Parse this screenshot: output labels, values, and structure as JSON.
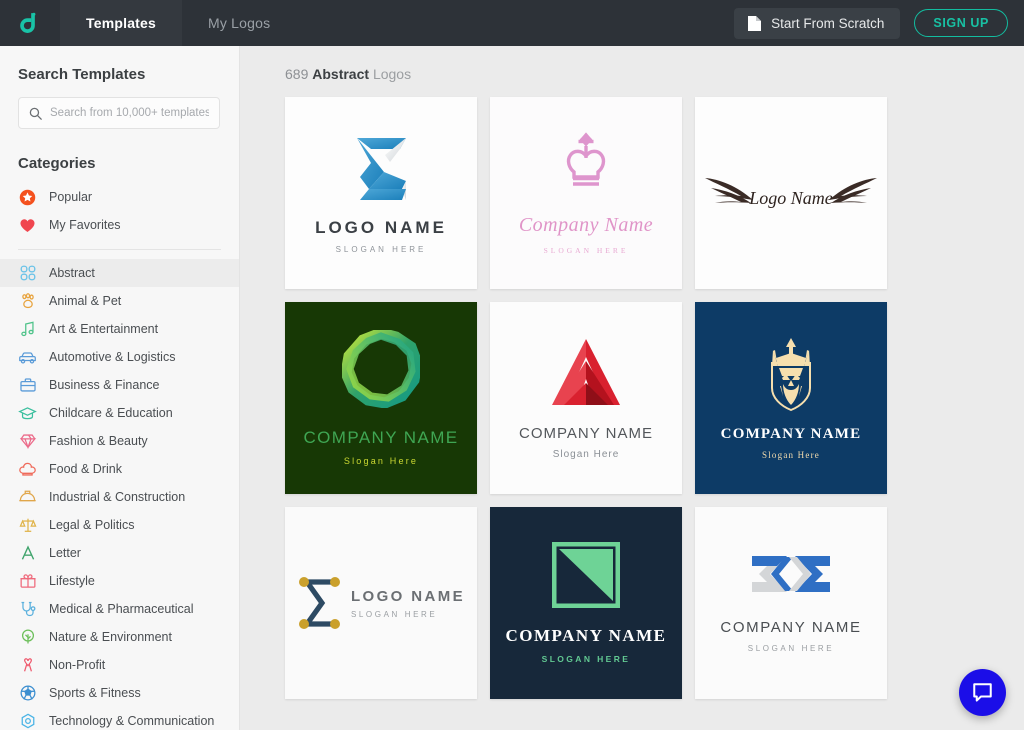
{
  "topbar": {
    "brand_icon": "logo-mark-icon",
    "tabs": [
      {
        "label": "Templates",
        "active": true
      },
      {
        "label": "My Logos",
        "active": false
      }
    ],
    "scratch_label": "Start From Scratch",
    "scratch_icon": "document-icon",
    "signup_label": "SIGN UP",
    "colors": {
      "bar_bg": "#2d3238",
      "tab_active_bg": "#34393f",
      "accent": "#18c0a3"
    }
  },
  "sidebar": {
    "search_title": "Search Templates",
    "search_placeholder": "Search from 10,000+ templates...",
    "search_value": "",
    "search_icon": "search-icon",
    "categories_title": "Categories",
    "quick": [
      {
        "label": "Popular",
        "icon": "star-badge-icon",
        "color": "#f4511e"
      },
      {
        "label": "My Favorites",
        "icon": "heart-icon",
        "color": "#f0464f"
      }
    ],
    "items": [
      {
        "label": "Abstract",
        "icon": "abstract-knot-icon",
        "color": "#6cc3e8",
        "active": true
      },
      {
        "label": "Animal & Pet",
        "icon": "paw-icon",
        "color": "#e8a33d",
        "active": false
      },
      {
        "label": "Art & Entertainment",
        "icon": "music-note-icon",
        "color": "#4fc38a",
        "active": false
      },
      {
        "label": "Automotive & Logistics",
        "icon": "car-icon",
        "color": "#5a9bd8",
        "active": false
      },
      {
        "label": "Business & Finance",
        "icon": "briefcase-icon",
        "color": "#5a9bd8",
        "active": false
      },
      {
        "label": "Childcare & Education",
        "icon": "graduation-cap-icon",
        "color": "#3bbf9e",
        "active": false
      },
      {
        "label": "Fashion & Beauty",
        "icon": "diamond-icon",
        "color": "#ec6b8a",
        "active": false
      },
      {
        "label": "Food & Drink",
        "icon": "chef-hat-icon",
        "color": "#ef6a5a",
        "active": false
      },
      {
        "label": "Industrial & Construction",
        "icon": "hard-hat-icon",
        "color": "#e0a64a",
        "active": false
      },
      {
        "label": "Legal & Politics",
        "icon": "scales-icon",
        "color": "#e0b44a",
        "active": false
      },
      {
        "label": "Letter",
        "icon": "letter-a-icon",
        "color": "#3fa36b",
        "active": false
      },
      {
        "label": "Lifestyle",
        "icon": "gift-icon",
        "color": "#ef6a7c",
        "active": false
      },
      {
        "label": "Medical & Pharmaceutical",
        "icon": "stethoscope-icon",
        "color": "#5ab0dd",
        "active": false
      },
      {
        "label": "Nature & Environment",
        "icon": "tree-icon",
        "color": "#6cbf5a",
        "active": false
      },
      {
        "label": "Non-Profit",
        "icon": "ribbon-icon",
        "color": "#ef5a6e",
        "active": false
      },
      {
        "label": "Sports & Fitness",
        "icon": "soccer-ball-icon",
        "color": "#3b8ed0",
        "active": false
      },
      {
        "label": "Technology & Communication",
        "icon": "hexagon-tech-icon",
        "color": "#4ab4e6",
        "active": false
      }
    ]
  },
  "main": {
    "result_count": "689",
    "result_category": "Abstract",
    "result_suffix": "Logos",
    "cards": [
      {
        "art": "sigma-ribbon",
        "name": "LOGO NAME",
        "slogan": "SLOGAN HERE",
        "bg": "#fdfdfd",
        "name_color": "#3b4045",
        "slogan_color": "#8f949a",
        "name_size": "17px",
        "slogan_size": "8px",
        "name_weight": "bold",
        "name_font": "sans"
      },
      {
        "art": "pink-crown",
        "name": "Company Name",
        "slogan": "SLOGAN HERE",
        "bg": "#fcfbfc",
        "name_color": "#e094c8",
        "slogan_color": "#e8a9d2",
        "name_size": "20px",
        "slogan_size": "7.5px",
        "name_weight": "normal",
        "name_font": "serif-italic"
      },
      {
        "art": "wings",
        "name": "Logo Name",
        "slogan": "",
        "bg": "#fdfdfd",
        "name_color": "#2f2420",
        "slogan_color": "",
        "name_size": "17px",
        "slogan_size": "0px",
        "name_weight": "normal",
        "name_font": "serif-italic"
      },
      {
        "art": "green-ring",
        "name": "COMPANY NAME",
        "slogan": "Slogan Here",
        "bg": "#173805",
        "name_color": "#3fa653",
        "slogan_color": "#cbd832",
        "name_size": "17px",
        "slogan_size": "9px",
        "name_weight": "normal",
        "name_font": "sans"
      },
      {
        "art": "red-triangle",
        "name": "COMPANY NAME",
        "slogan": "Slogan Here",
        "bg": "#fcfcfc",
        "name_color": "#53575b",
        "slogan_color": "#8a8f95",
        "name_size": "15px",
        "slogan_size": "10px",
        "name_weight": "normal",
        "name_font": "sans"
      },
      {
        "art": "king-shield",
        "name": "COMPANY NAME",
        "slogan": "Slogan Here",
        "bg": "#0d3b66",
        "name_color": "#ffffff",
        "slogan_color": "#f3dcae",
        "name_size": "15px",
        "slogan_size": "9px",
        "name_weight": "bold",
        "name_font": "serif"
      },
      {
        "art": "sigma-dots",
        "name": "LOGO NAME",
        "slogan": "SLOGAN HERE",
        "bg": "#fafafa",
        "name_color": "#6b6f73",
        "slogan_color": "#9a9ea2",
        "name_size": "15px",
        "slogan_size": "8px",
        "name_weight": "bold",
        "name_font": "sans"
      },
      {
        "art": "green-square",
        "name": "COMPANY NAME",
        "slogan": "SLOGAN HERE",
        "bg": "#17283a",
        "name_color": "#ffffff",
        "slogan_color": "#62c992",
        "name_size": "17px",
        "slogan_size": "8.5px",
        "name_weight": "bold",
        "name_font": "serif"
      },
      {
        "art": "blue-infinity",
        "name": "COMPANY NAME",
        "slogan": "SLOGAN HERE",
        "bg": "#fbfbfb",
        "name_color": "#4a4e52",
        "slogan_color": "#9a9ea2",
        "name_size": "15px",
        "slogan_size": "8px",
        "name_weight": "normal",
        "name_font": "sans"
      }
    ]
  },
  "chat": {
    "icon": "chat-bubble-icon",
    "color": "#1b0ee8"
  }
}
